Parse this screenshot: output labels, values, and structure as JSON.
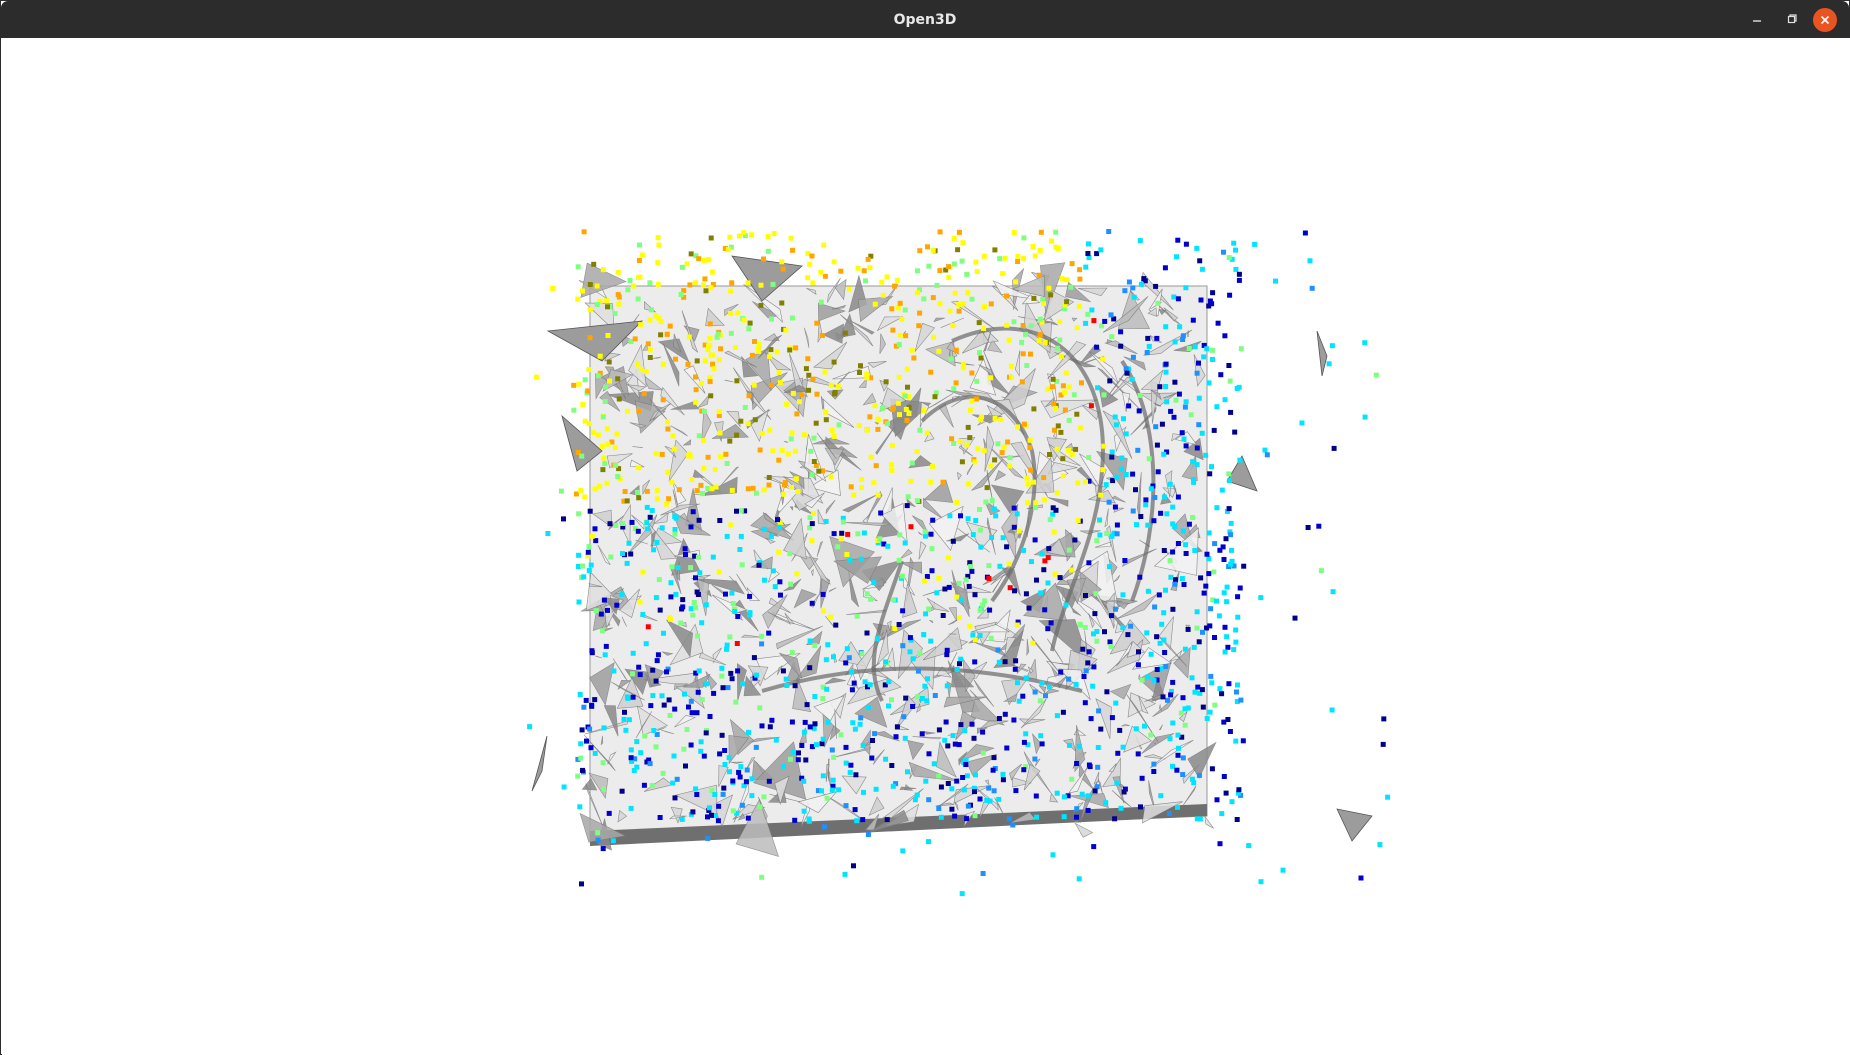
{
  "window": {
    "title": "Open3D",
    "controls": {
      "minimize_icon": "minimize-icon",
      "restore_icon": "restore-icon",
      "close_icon": "close-icon"
    }
  },
  "viewer": {
    "background_color": "#ffffff",
    "mesh_color": "#d9d9d9",
    "point_colors": [
      "#ffff00",
      "#ffa500",
      "#1e90ff",
      "#00e5ff",
      "#0000cd",
      "#00008b",
      "#7fff7f",
      "#ff0000",
      "#808000"
    ]
  },
  "colors": {
    "titlebar": "#2c2c2c",
    "close_accent": "#e95420"
  }
}
